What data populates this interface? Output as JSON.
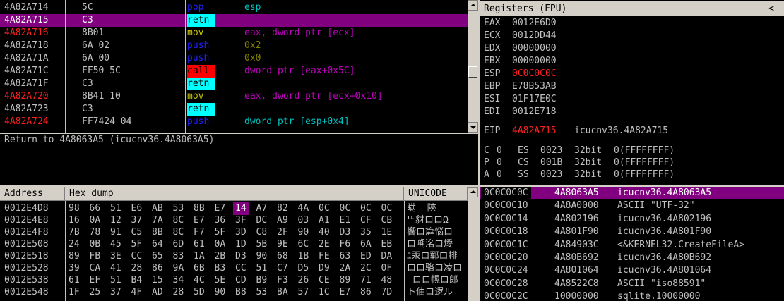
{
  "disasm": {
    "rows": [
      {
        "addr": "4A82A714",
        "addr_color": "w",
        "hex": "5C",
        "mn": "pop",
        "mn_style": "blue",
        "op": "esp",
        "op_color": "cyan",
        "selected": false
      },
      {
        "addr": "4A82A715",
        "addr_color": "w",
        "hex": "C3",
        "mn": "retn",
        "mn_style": "cyanbg",
        "op": "",
        "op_color": "w",
        "selected": true
      },
      {
        "addr": "4A82A716",
        "addr_color": "red",
        "hex": "8B01",
        "mn": "mov",
        "mn_style": "yel",
        "op": "eax, dword ptr [ecx]",
        "op_color": "mag",
        "selected": false
      },
      {
        "addr": "4A82A718",
        "addr_color": "w",
        "hex": "6A 02",
        "mn": "push",
        "mn_style": "blue",
        "op": "0x2",
        "op_color": "dim",
        "selected": false
      },
      {
        "addr": "4A82A71A",
        "addr_color": "w",
        "hex": "6A 00",
        "mn": "push",
        "mn_style": "blue",
        "op": "0x0",
        "op_color": "dim",
        "selected": false
      },
      {
        "addr": "4A82A71C",
        "addr_color": "w",
        "hex": "FF50 5C",
        "mn": "call",
        "mn_style": "redbg",
        "op": "dword ptr [eax+0x5C]",
        "op_color": "mag",
        "selected": false
      },
      {
        "addr": "4A82A71F",
        "addr_color": "w",
        "hex": "C3",
        "mn": "retn",
        "mn_style": "cyanbg",
        "op": "",
        "op_color": "w",
        "selected": false
      },
      {
        "addr": "4A82A720",
        "addr_color": "red",
        "hex": "8B41 10",
        "mn": "mov",
        "mn_style": "yel",
        "op": "eax, dword ptr [ecx+0x10]",
        "op_color": "mag",
        "selected": false
      },
      {
        "addr": "4A82A723",
        "addr_color": "w",
        "hex": "C3",
        "mn": "retn",
        "mn_style": "cyanbg",
        "op": "",
        "op_color": "w",
        "selected": false
      },
      {
        "addr": "4A82A724",
        "addr_color": "red",
        "hex": "FF7424 04",
        "mn": "push",
        "mn_style": "blue",
        "op": "dword ptr [esp+0x4]",
        "op_color": "cyan",
        "selected": false
      }
    ]
  },
  "info": {
    "text": "Return to 4A8063A5 (icucnv36.4A8063A5)"
  },
  "registers": {
    "title": "Registers (FPU)",
    "collapse": "<",
    "gp": [
      {
        "name": "EAX",
        "value": "0012E6D0",
        "changed": false
      },
      {
        "name": "ECX",
        "value": "0012DD44",
        "changed": false
      },
      {
        "name": "EDX",
        "value": "00000000",
        "changed": false
      },
      {
        "name": "EBX",
        "value": "00000000",
        "changed": false
      },
      {
        "name": "ESP",
        "value": "0C0C0C0C",
        "changed": true
      },
      {
        "name": "EBP",
        "value": "E78B53AB",
        "changed": false
      },
      {
        "name": "ESI",
        "value": "01F17E0C",
        "changed": false
      },
      {
        "name": "EDI",
        "value": "0012E718",
        "changed": false
      }
    ],
    "eip": {
      "name": "EIP",
      "value": "4A82A715",
      "comment": "icucnv36.4A82A715"
    },
    "flags": [
      {
        "flag": "C",
        "fv": "0",
        "seg": "ES",
        "sv": "0023",
        "bits": "32bit",
        "range": "0(FFFFFFFF)"
      },
      {
        "flag": "P",
        "fv": "0",
        "seg": "CS",
        "sv": "001B",
        "bits": "32bit",
        "range": "0(FFFFFFFF)"
      },
      {
        "flag": "A",
        "fv": "0",
        "seg": "SS",
        "sv": "0023",
        "bits": "32bit",
        "range": "0(FFFFFFFF)"
      }
    ]
  },
  "dump": {
    "headers": {
      "address": "Address",
      "hex": "Hex dump",
      "unicode": "UNICODE"
    },
    "rows": [
      {
        "addr": "0012E4D8",
        "bytes": [
          "98",
          "66",
          "51",
          "E6",
          "AB",
          "53",
          "8B",
          "E7",
          "14",
          "A7",
          "82",
          "4A",
          "0C",
          "0C",
          "0C",
          "0C"
        ],
        "hl": 8,
        "uni": "瞒  陝  "
      },
      {
        "addr": "0012E4E8",
        "bytes": [
          "16",
          "0A",
          "12",
          "37",
          "7A",
          "8C",
          "E7",
          "36",
          "3F",
          "DC",
          "A9",
          "03",
          "A1",
          "E1",
          "CF",
          "CB"
        ],
        "hl": -1,
        "uni": "ᄔ豺ロロΩ"
      },
      {
        "addr": "0012E4F8",
        "bytes": [
          "7B",
          "78",
          "91",
          "C5",
          "8B",
          "8C",
          "F7",
          "5F",
          "3D",
          "C8",
          "2F",
          "90",
          "40",
          "D3",
          "35",
          "1E"
        ],
        "hl": -1,
        "uni": "響ロ簈悩ロ"
      },
      {
        "addr": "0012E508",
        "bytes": [
          "24",
          "0B",
          "45",
          "5F",
          "64",
          "6D",
          "61",
          "0A",
          "1D",
          "5B",
          "9E",
          "6C",
          "2E",
          "F6",
          "6A",
          "EB"
        ],
        "hl": -1,
        "uni": "ロ嗍洺ロ燰"
      },
      {
        "addr": "0012E518",
        "bytes": [
          "89",
          "FB",
          "3E",
          "CC",
          "65",
          "83",
          "1A",
          "2B",
          "D3",
          "90",
          "68",
          "1B",
          "FE",
          "63",
          "ED",
          "DA"
        ],
        "hl": -1,
        "uni": "ﾕ汞ロ郓ロ排"
      },
      {
        "addr": "0012E528",
        "bytes": [
          "39",
          "CA",
          "41",
          "28",
          "86",
          "9A",
          "6B",
          "B3",
          "CC",
          "51",
          "C7",
          "D5",
          "D9",
          "2A",
          "2C",
          "0F"
        ],
        "hl": -1,
        "uni": "ロロ骆ロ凌ロ"
      },
      {
        "addr": "0012E538",
        "bytes": [
          "61",
          "EF",
          "51",
          "B4",
          "15",
          "34",
          "4C",
          "5E",
          "CD",
          "B9",
          "F3",
          "26",
          "CE",
          "89",
          "71",
          "48"
        ],
        "hl": -1,
        "uni": " ロロ幌ロ郎"
      },
      {
        "addr": "0012E548",
        "bytes": [
          "1F",
          "25",
          "37",
          "4F",
          "AD",
          "28",
          "5D",
          "90",
          "B8",
          "53",
          "BA",
          "57",
          "1C",
          "E7",
          "86",
          "7D"
        ],
        "hl": -1,
        "uni": "ト伷ロ逻ル"
      }
    ]
  },
  "stack": {
    "rows": [
      {
        "addr": "0C0C0C0C",
        "val": "4A8063A5",
        "comment": "icucnv36.4A8063A5",
        "selected": true
      },
      {
        "addr": "0C0C0C10",
        "val": "4A8A0000",
        "comment": "ASCII \"UTF-32\"",
        "selected": false
      },
      {
        "addr": "0C0C0C14",
        "val": "4A802196",
        "comment": "icucnv36.4A802196",
        "selected": false
      },
      {
        "addr": "0C0C0C18",
        "val": "4A801F90",
        "comment": "icucnv36.4A801F90",
        "selected": false
      },
      {
        "addr": "0C0C0C1C",
        "val": "4A84903C",
        "comment": "<&KERNEL32.CreateFileA>",
        "selected": false
      },
      {
        "addr": "0C0C0C20",
        "val": "4A80B692",
        "comment": "icucnv36.4A80B692",
        "selected": false
      },
      {
        "addr": "0C0C0C24",
        "val": "4A801064",
        "comment": "icucnv36.4A801064",
        "selected": false
      },
      {
        "addr": "0C0C0C28",
        "val": "4A8522C8",
        "comment": "ASCII \"iso88591\"",
        "selected": false
      },
      {
        "addr": "0C0C0C2C",
        "val": "10000000",
        "comment": "sqlite.10000000",
        "selected": false
      }
    ]
  },
  "colors": {
    "selection": "#800080",
    "changed_register": "#ff2020",
    "call_bg": "#ff0000",
    "retn_bg": "#00ffff"
  }
}
